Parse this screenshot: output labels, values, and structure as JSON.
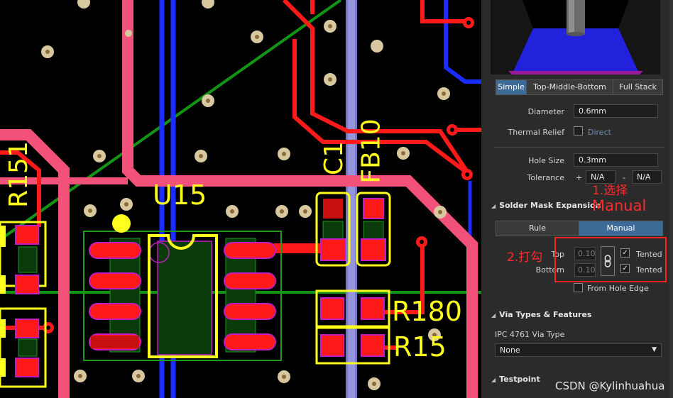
{
  "pcb": {
    "designators": {
      "u15": "U15",
      "r151": "R151",
      "c1": "C1",
      "fb10": "FB10",
      "r180": "R180",
      "r15": "R15"
    },
    "colors": {
      "background": "#000000",
      "track_red": "#ff1a1a",
      "track_pink": "#f2527a",
      "track_blue": "#1a2cff",
      "silkscreen": "#ffff1e",
      "via_pad": "#d8c8a0",
      "green_line": "#149414",
      "magenta": "#c21cc2"
    }
  },
  "panel": {
    "stack_tabs": {
      "simple": "Simple",
      "top_middle_bottom": "Top-Middle-Bottom",
      "full_stack": "Full Stack"
    },
    "diameter": {
      "label": "Diameter",
      "value": "0.6mm"
    },
    "thermal_relief": {
      "label": "Thermal Relief",
      "link": "Direct"
    },
    "hole_size": {
      "label": "Hole Size",
      "value": "0.3mm"
    },
    "tolerance": {
      "label": "Tolerance",
      "plus": "+",
      "plus_value": "N/A",
      "minus": "-",
      "minus_value": "N/A"
    },
    "solder_mask": {
      "title": "Solder Mask Expansion",
      "tab_rule": "Rule",
      "tab_manual": "Manual",
      "top_label": "Top",
      "top_value": "0.10",
      "top_tented": "Tented",
      "bottom_label": "Bottom",
      "bottom_value": "0.10",
      "bottom_tented": "Tented",
      "from_hole_edge": "From Hole Edge"
    },
    "via_types": {
      "title": "Via Types & Features",
      "ipc_label": "IPC 4761 Via Type",
      "ipc_value": "None"
    },
    "testpoint": {
      "title": "Testpoint"
    }
  },
  "annotations": {
    "step1_line1": "1.选择",
    "step1_line2": "Manual",
    "step2": "2.打勾"
  },
  "watermark": "CSDN @Kylinhuahua"
}
